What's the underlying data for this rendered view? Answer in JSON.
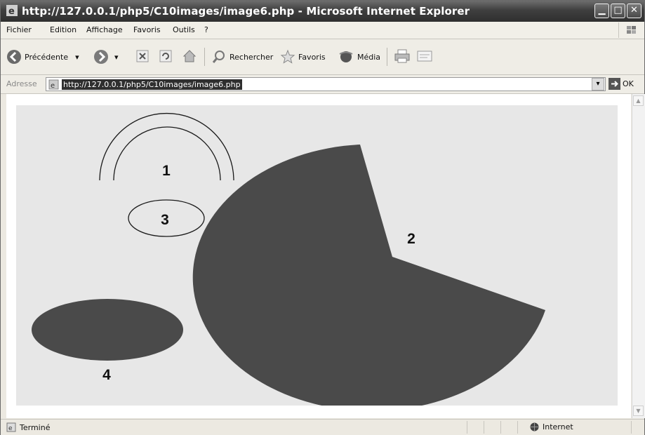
{
  "window": {
    "title": "http://127.0.0.1/php5/C10images/image6.php - Microsoft Internet Explorer",
    "controls": [
      "minimize",
      "maximize",
      "close"
    ]
  },
  "menu": [
    "Fichier",
    "Edition",
    "Affichage",
    "Favoris",
    "Outils",
    "?"
  ],
  "toolbar": {
    "back": "Précédente",
    "search": "Rechercher",
    "favorites": "Favoris",
    "media": "Média"
  },
  "address": {
    "label": "Adresse",
    "url": "http://127.0.0.1/php5/C10images/image6.php",
    "go": "OK"
  },
  "drawing": {
    "labels": {
      "arcs": "1",
      "pie": "2",
      "ellipse_outline": "3",
      "ellipse_filled": "4"
    },
    "fill_color": "#4a4a4a",
    "background_color": "#e7e7e7"
  },
  "status": {
    "text": "Terminé",
    "zone": "Internet"
  },
  "colors": {
    "titlebar": "#3f3f3f",
    "chrome": "#ece9e1",
    "address_highlight": "#2f2f2f"
  }
}
